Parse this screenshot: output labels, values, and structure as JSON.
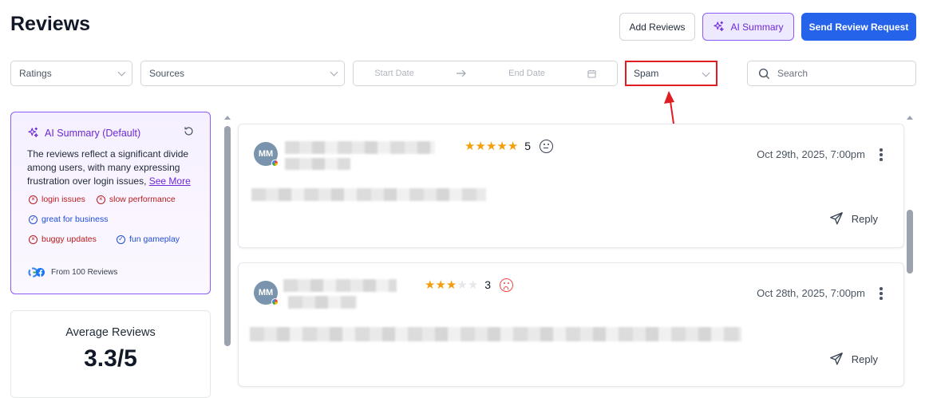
{
  "header": {
    "title": "Reviews",
    "add_reviews_label": "Add Reviews",
    "ai_summary_label": "AI Summary",
    "send_request_label": "Send Review Request"
  },
  "filters": {
    "ratings_placeholder": "Ratings",
    "sources_placeholder": "Sources",
    "start_date_placeholder": "Start Date",
    "end_date_placeholder": "End Date",
    "spam_value": "Spam",
    "search_placeholder": "Search"
  },
  "ai_summary": {
    "title": "AI Summary (Default)",
    "text": "The reviews reflect a significant divide among users, with many expressing frustration over login issues,",
    "see_more": "See More",
    "tags": [
      {
        "label": "login issues",
        "type": "negative"
      },
      {
        "label": "slow performance",
        "type": "negative"
      },
      {
        "label": "great for business",
        "type": "positive"
      },
      {
        "label": "buggy updates",
        "type": "negative"
      },
      {
        "label": "fun gameplay",
        "type": "positive"
      }
    ],
    "footer": "From 100 Reviews"
  },
  "average": {
    "label": "Average Reviews",
    "value": "3.3/5"
  },
  "reviews": [
    {
      "initials": "MM",
      "rating": 5,
      "rating_label": "5",
      "sentiment": "neutral",
      "date": "Oct 29th, 2025, 7:00pm",
      "reply_label": "Reply"
    },
    {
      "initials": "MM",
      "rating": 3,
      "rating_label": "3",
      "sentiment": "sad",
      "date": "Oct 28th, 2025, 7:00pm",
      "reply_label": "Reply"
    }
  ],
  "colors": {
    "primary": "#2563eb",
    "ai_accent": "#6d28d9",
    "star": "#f59e0b",
    "annotation": "#e11d24"
  }
}
